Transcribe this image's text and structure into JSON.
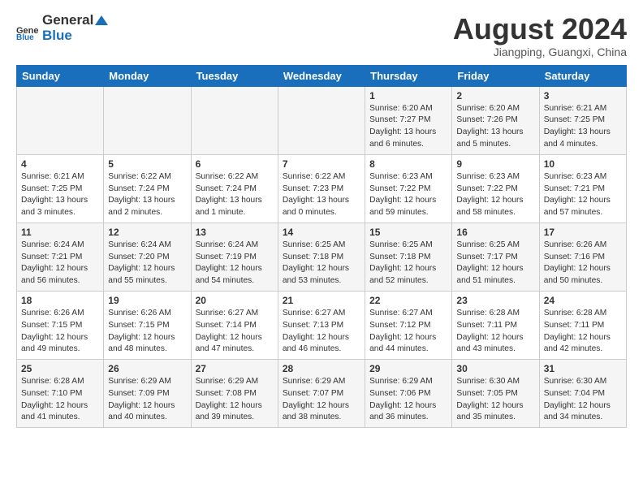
{
  "header": {
    "logo_general": "General",
    "logo_blue": "Blue",
    "month_year": "August 2024",
    "location": "Jiangping, Guangxi, China"
  },
  "days_of_week": [
    "Sunday",
    "Monday",
    "Tuesday",
    "Wednesday",
    "Thursday",
    "Friday",
    "Saturday"
  ],
  "weeks": [
    [
      {
        "day": "",
        "info": ""
      },
      {
        "day": "",
        "info": ""
      },
      {
        "day": "",
        "info": ""
      },
      {
        "day": "",
        "info": ""
      },
      {
        "day": "1",
        "info": "Sunrise: 6:20 AM\nSunset: 7:27 PM\nDaylight: 13 hours\nand 6 minutes."
      },
      {
        "day": "2",
        "info": "Sunrise: 6:20 AM\nSunset: 7:26 PM\nDaylight: 13 hours\nand 5 minutes."
      },
      {
        "day": "3",
        "info": "Sunrise: 6:21 AM\nSunset: 7:25 PM\nDaylight: 13 hours\nand 4 minutes."
      }
    ],
    [
      {
        "day": "4",
        "info": "Sunrise: 6:21 AM\nSunset: 7:25 PM\nDaylight: 13 hours\nand 3 minutes."
      },
      {
        "day": "5",
        "info": "Sunrise: 6:22 AM\nSunset: 7:24 PM\nDaylight: 13 hours\nand 2 minutes."
      },
      {
        "day": "6",
        "info": "Sunrise: 6:22 AM\nSunset: 7:24 PM\nDaylight: 13 hours\nand 1 minute."
      },
      {
        "day": "7",
        "info": "Sunrise: 6:22 AM\nSunset: 7:23 PM\nDaylight: 13 hours\nand 0 minutes."
      },
      {
        "day": "8",
        "info": "Sunrise: 6:23 AM\nSunset: 7:22 PM\nDaylight: 12 hours\nand 59 minutes."
      },
      {
        "day": "9",
        "info": "Sunrise: 6:23 AM\nSunset: 7:22 PM\nDaylight: 12 hours\nand 58 minutes."
      },
      {
        "day": "10",
        "info": "Sunrise: 6:23 AM\nSunset: 7:21 PM\nDaylight: 12 hours\nand 57 minutes."
      }
    ],
    [
      {
        "day": "11",
        "info": "Sunrise: 6:24 AM\nSunset: 7:21 PM\nDaylight: 12 hours\nand 56 minutes."
      },
      {
        "day": "12",
        "info": "Sunrise: 6:24 AM\nSunset: 7:20 PM\nDaylight: 12 hours\nand 55 minutes."
      },
      {
        "day": "13",
        "info": "Sunrise: 6:24 AM\nSunset: 7:19 PM\nDaylight: 12 hours\nand 54 minutes."
      },
      {
        "day": "14",
        "info": "Sunrise: 6:25 AM\nSunset: 7:18 PM\nDaylight: 12 hours\nand 53 minutes."
      },
      {
        "day": "15",
        "info": "Sunrise: 6:25 AM\nSunset: 7:18 PM\nDaylight: 12 hours\nand 52 minutes."
      },
      {
        "day": "16",
        "info": "Sunrise: 6:25 AM\nSunset: 7:17 PM\nDaylight: 12 hours\nand 51 minutes."
      },
      {
        "day": "17",
        "info": "Sunrise: 6:26 AM\nSunset: 7:16 PM\nDaylight: 12 hours\nand 50 minutes."
      }
    ],
    [
      {
        "day": "18",
        "info": "Sunrise: 6:26 AM\nSunset: 7:15 PM\nDaylight: 12 hours\nand 49 minutes."
      },
      {
        "day": "19",
        "info": "Sunrise: 6:26 AM\nSunset: 7:15 PM\nDaylight: 12 hours\nand 48 minutes."
      },
      {
        "day": "20",
        "info": "Sunrise: 6:27 AM\nSunset: 7:14 PM\nDaylight: 12 hours\nand 47 minutes."
      },
      {
        "day": "21",
        "info": "Sunrise: 6:27 AM\nSunset: 7:13 PM\nDaylight: 12 hours\nand 46 minutes."
      },
      {
        "day": "22",
        "info": "Sunrise: 6:27 AM\nSunset: 7:12 PM\nDaylight: 12 hours\nand 44 minutes."
      },
      {
        "day": "23",
        "info": "Sunrise: 6:28 AM\nSunset: 7:11 PM\nDaylight: 12 hours\nand 43 minutes."
      },
      {
        "day": "24",
        "info": "Sunrise: 6:28 AM\nSunset: 7:11 PM\nDaylight: 12 hours\nand 42 minutes."
      }
    ],
    [
      {
        "day": "25",
        "info": "Sunrise: 6:28 AM\nSunset: 7:10 PM\nDaylight: 12 hours\nand 41 minutes."
      },
      {
        "day": "26",
        "info": "Sunrise: 6:29 AM\nSunset: 7:09 PM\nDaylight: 12 hours\nand 40 minutes."
      },
      {
        "day": "27",
        "info": "Sunrise: 6:29 AM\nSunset: 7:08 PM\nDaylight: 12 hours\nand 39 minutes."
      },
      {
        "day": "28",
        "info": "Sunrise: 6:29 AM\nSunset: 7:07 PM\nDaylight: 12 hours\nand 38 minutes."
      },
      {
        "day": "29",
        "info": "Sunrise: 6:29 AM\nSunset: 7:06 PM\nDaylight: 12 hours\nand 36 minutes."
      },
      {
        "day": "30",
        "info": "Sunrise: 6:30 AM\nSunset: 7:05 PM\nDaylight: 12 hours\nand 35 minutes."
      },
      {
        "day": "31",
        "info": "Sunrise: 6:30 AM\nSunset: 7:04 PM\nDaylight: 12 hours\nand 34 minutes."
      }
    ]
  ]
}
